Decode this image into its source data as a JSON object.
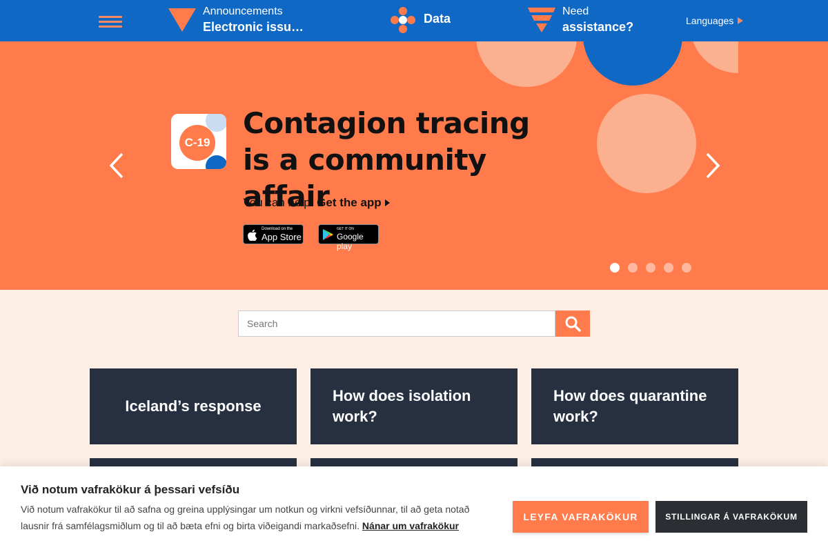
{
  "nav": {
    "announcements_label": "Announcements",
    "announcements_item": "Electronic issu…",
    "data_label": "Data",
    "need_label": "Need",
    "assistance_label": "assistance?",
    "languages_label": "Languages"
  },
  "hero": {
    "logo_text": "C-19",
    "title": "Contagion tracing is a community affair",
    "sub_text": "You can help.",
    "get_app_label": "Get the app",
    "appstore_small": "Download on the",
    "appstore_big": "App Store",
    "googleplay_small": "GET IT ON",
    "googleplay_big": "Google play",
    "slide_count": 5,
    "active_slide": 1
  },
  "search": {
    "placeholder": "Search"
  },
  "cards": [
    {
      "label": "Iceland’s response"
    },
    {
      "label": "How does isolation work?"
    },
    {
      "label": "How does quarantine work?"
    }
  ],
  "cookie": {
    "title": "Við notum vafrakökur á þessari vefsíðu",
    "text": "Við notum vafrakökur til að safna og greina upplýsingar um notkun og virkni vefsíðunnar, til að geta notað lausnir frá samfélagsmiðlum og til að bæta efni og birta viðeigandi markaðsefni.",
    "link": "Nánar um vafrakökur",
    "allow_button": "LEYFA VAFRAKÖKUR",
    "settings_button": "STILLINGAR Á VAFRAKÖKUM"
  },
  "colors": {
    "nav_bg": "#0f68c3",
    "accent_orange": "#ff7b4c",
    "card_bg": "#263040",
    "page_bg": "#fdeee6"
  }
}
